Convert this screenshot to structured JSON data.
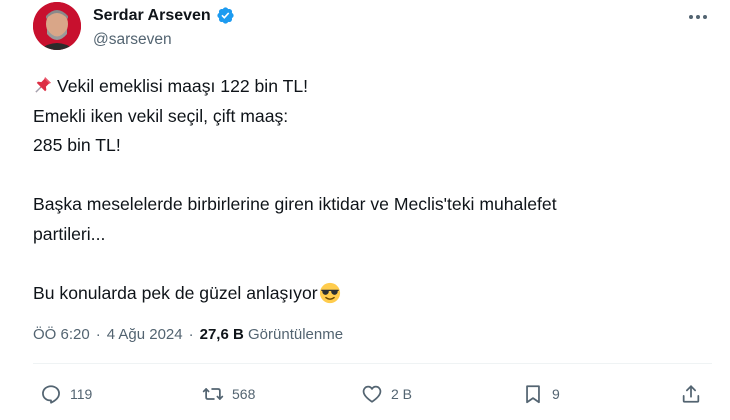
{
  "author": {
    "name": "Serdar Arseven",
    "handle": "@sarseven",
    "verified": true
  },
  "tweet": {
    "line1": "Vekil emeklisi maaşı 122 bin TL!",
    "line2": "Emekli iken vekil seçil, çift maaş:",
    "line3": "285 bin TL!",
    "line4": "Başka meselelerde birbirlerine giren iktidar ve Meclis'teki muhalefet",
    "line5": "partileri...",
    "line6": "Bu konularda pek de güzel anlaşıyor",
    "emoji_start": "pushpin",
    "emoji_end": "smiling-face-with-sunglasses"
  },
  "meta": {
    "time": "ÖÖ 6:20",
    "separator": "·",
    "date": "4 Ağu 2024",
    "views_count": "27,6 B",
    "views_label": "Görüntülenme"
  },
  "actions": {
    "replies": "119",
    "reposts": "568",
    "likes": "2 B",
    "bookmarks": "9"
  },
  "colors": {
    "verified": "#1d9bf0",
    "muted": "#536471",
    "text": "#0f1419"
  }
}
